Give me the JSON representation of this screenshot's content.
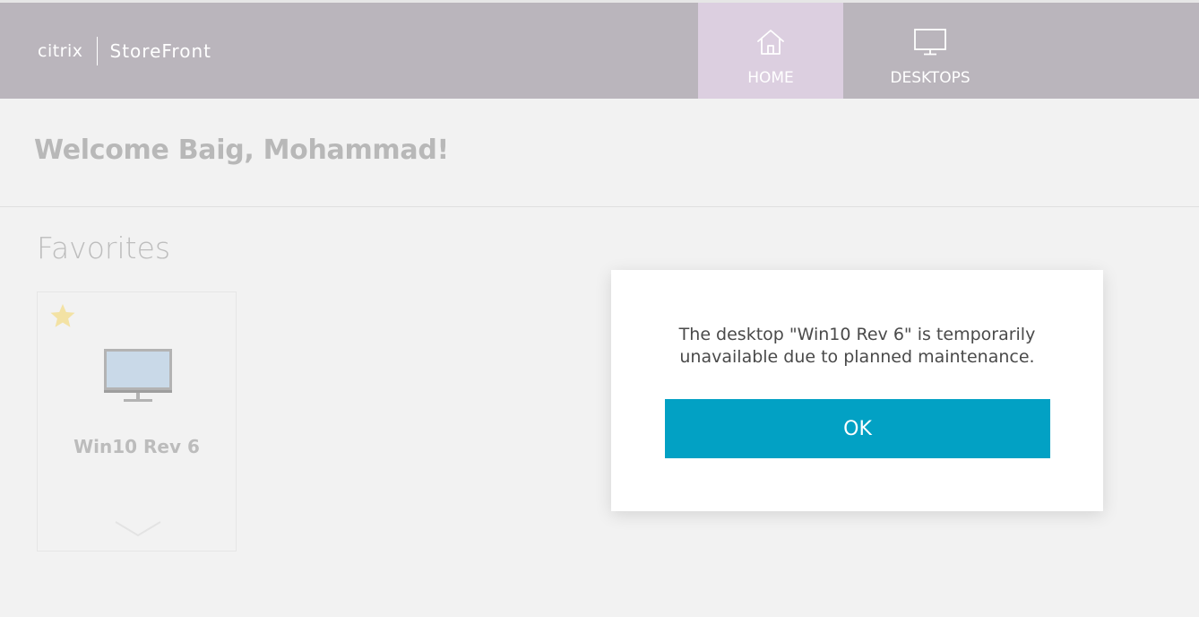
{
  "header": {
    "brand": "citrix",
    "product": "StoreFront",
    "nav": [
      {
        "label": "HOME",
        "icon": "home-icon",
        "active": true
      },
      {
        "label": "DESKTOPS",
        "icon": "monitor-icon",
        "active": false
      }
    ]
  },
  "welcome": {
    "text": "Welcome Baig, Mohammad!"
  },
  "favorites": {
    "title": "Favorites",
    "items": [
      {
        "label": "Win10 Rev 6",
        "icon": "desktop-monitor-icon",
        "favorite": true
      }
    ]
  },
  "dialog": {
    "message": "The desktop \"Win10 Rev 6\" is temporarily\nunavailable due to planned maintenance.",
    "ok_label": "OK"
  },
  "colors": {
    "header_bg": "#bab5bc",
    "active_tab_bg": "#dccfe0",
    "ok_button": "#02a1c4",
    "star": "#f3e2a4"
  }
}
